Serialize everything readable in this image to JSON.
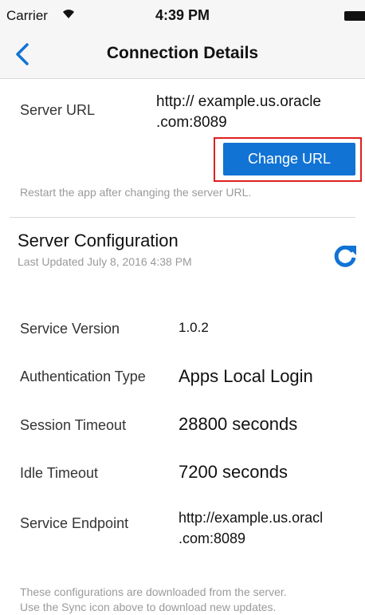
{
  "status_bar": {
    "carrier": "Carrier",
    "time": "4:39 PM"
  },
  "nav": {
    "title": "Connection Details"
  },
  "server_url": {
    "label": "Server URL",
    "value_line1": "http:// example.us.oracle",
    "value_line2": ".com:8089",
    "button_label": "Change URL",
    "note": "Restart the app after changing the server URL."
  },
  "config": {
    "title": "Server Configuration",
    "last_updated": "Last Updated July 8, 2016 4:38 PM",
    "rows": [
      {
        "label": "Service Version",
        "value": "1.0.2"
      },
      {
        "label": "Authentication Type",
        "value": "Apps Local Login"
      },
      {
        "label": "Session Timeout",
        "value": "28800 seconds"
      },
      {
        "label": "Idle Timeout",
        "value": "7200 seconds"
      },
      {
        "label": "Service Endpoint",
        "value_line1": "http://example.us.oracl",
        "value_line2": ".com:8089"
      }
    ],
    "footer_line1": "These configurations are downloaded from the server.",
    "footer_line2": "Use the Sync icon above to download new updates."
  },
  "colors": {
    "accent": "#1173d4",
    "highlight": "#e01f1f"
  }
}
